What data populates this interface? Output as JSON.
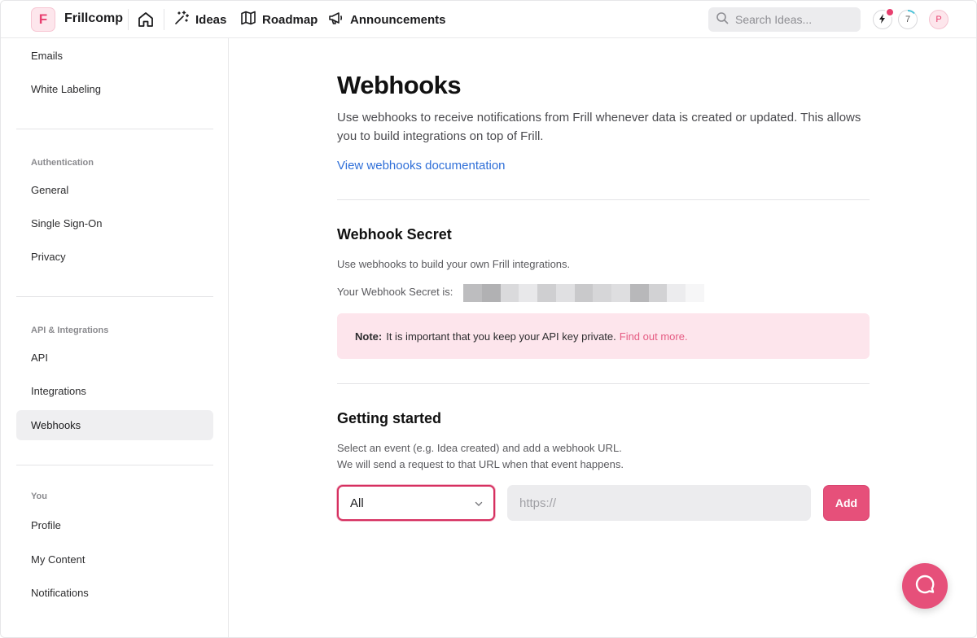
{
  "brand": {
    "logo_letter": "F",
    "name": "Frillcomp"
  },
  "nav": {
    "home_icon": "home-icon",
    "items": [
      {
        "label": "Ideas",
        "icon": "sparkles-icon"
      },
      {
        "label": "Roadmap",
        "icon": "map-icon"
      },
      {
        "label": "Announcements",
        "icon": "megaphone-icon"
      }
    ]
  },
  "search": {
    "placeholder": "Search Ideas..."
  },
  "header_right": {
    "progress_count": "7",
    "avatar_letter": "P"
  },
  "sidebar": {
    "top_items": [
      {
        "label": "Emails"
      },
      {
        "label": "White Labeling"
      }
    ],
    "sections": [
      {
        "heading": "Authentication",
        "items": [
          {
            "label": "General"
          },
          {
            "label": "Single Sign-On"
          },
          {
            "label": "Privacy"
          }
        ]
      },
      {
        "heading": "API & Integrations",
        "items": [
          {
            "label": "API"
          },
          {
            "label": "Integrations"
          },
          {
            "label": "Webhooks"
          }
        ]
      },
      {
        "heading": "You",
        "items": [
          {
            "label": "Profile"
          },
          {
            "label": "My Content"
          },
          {
            "label": "Notifications"
          }
        ]
      }
    ],
    "active": "Webhooks"
  },
  "main": {
    "title": "Webhooks",
    "lead": "Use webhooks to receive notifications from Frill whenever data is created or updated. This allows you to build integrations on top of Frill.",
    "doc_link": "View webhooks documentation",
    "secret": {
      "heading": "Webhook Secret",
      "description": "Use webhooks to build your own Frill integrations.",
      "label": "Your Webhook Secret is:",
      "note_label": "Note:",
      "note_text": "It is important that you keep your API key private.",
      "note_link": "Find out more."
    },
    "getting_started": {
      "heading": "Getting started",
      "line1": "Select an event (e.g. Idea created) and add a webhook URL.",
      "line2": "We will send a request to that URL when that event happens.",
      "event_value": "All",
      "url_placeholder": "https://",
      "add_label": "Add"
    }
  },
  "colors": {
    "accent": "#e6507a",
    "link": "#2f6fd8",
    "note_bg": "#fde5ec"
  }
}
